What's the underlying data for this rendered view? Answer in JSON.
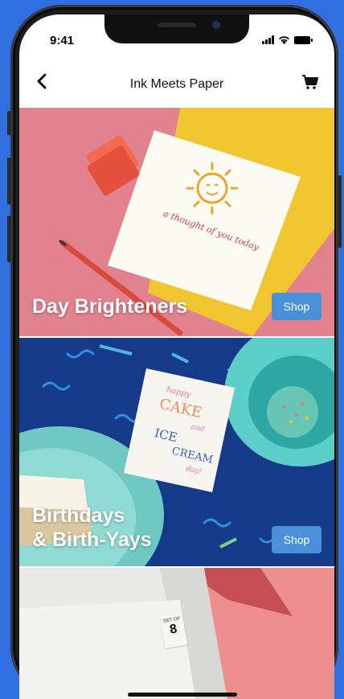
{
  "status_bar": {
    "time": "9:41"
  },
  "nav": {
    "title": "Ink Meets Paper"
  },
  "panels": [
    {
      "title": "Day Brighteners",
      "shop_label": "Shop",
      "card_text": "a thought of you today"
    },
    {
      "title_line1": "Birthdays",
      "title_line2": "& Birth-Yays",
      "shop_label": "Shop",
      "card_text": [
        "happy",
        "CAKE",
        "and",
        "ICE",
        "CREAM",
        "day!"
      ]
    },
    {
      "badge_top": "SET OF",
      "badge_num": "8"
    }
  ],
  "colors": {
    "accent": "#4a90d9",
    "background": "#2f6fe0"
  }
}
